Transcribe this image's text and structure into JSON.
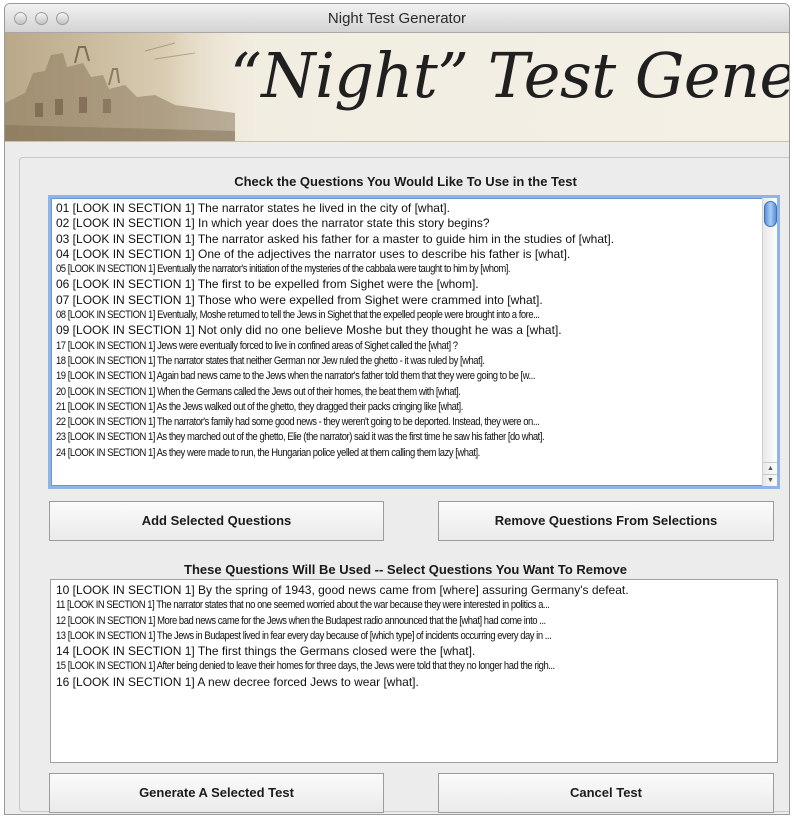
{
  "window": {
    "title": "Night Test Generator"
  },
  "banner": {
    "title": "“Night” Test Generator"
  },
  "available_section": {
    "label": "Check the Questions You Would Like To Use in the Test",
    "items": [
      "01 [LOOK IN SECTION 1]   The narrator states he lived in the city of [what].",
      "02 [LOOK IN SECTION 1]   In which year does the narrator state this story begins?",
      "03 [LOOK IN SECTION 1]   The narrator asked his father for a master to guide him in the studies of [what].",
      "04 [LOOK IN SECTION 1]   One of the adjectives the narrator uses to describe his father is [what].",
      "05 [LOOK IN SECTION 1]  Eventually the narrator's initiation of the mysteries of the cabbala were taught to him by [whom].",
      "06 [LOOK IN SECTION 1]   The first to be expelled from Sighet were the [whom].",
      "07 [LOOK IN SECTION 1]   Those who were expelled from Sighet were crammed into [what].",
      "08 [LOOK IN SECTION 1]  Eventually, Moshe returned to tell the Jews in Sighet that the expelled people were brought into a fore...",
      "09 [LOOK IN SECTION 1]   Not only did no one believe Moshe but they thought he was a [what].",
      "17 [LOOK IN SECTION 1]  Jews were eventually forced to live in confined areas of Sighet called the [what]  ?",
      "18 [LOOK IN SECTION 1]  The narrator states that neither German nor Jew ruled the ghetto - it was ruled by [what].",
      "19 [LOOK IN SECTION 1]  Again bad news came to the Jews when the narrator's father told them  that they were going to be [w...",
      "20 [LOOK IN SECTION 1]  When the Germans called the Jews out of their homes, the beat them with [what].",
      "21 [LOOK IN SECTION 1]  As the Jews walked out of the ghetto, they dragged their packs cringing like [what].",
      "22 [LOOK IN SECTION 1]  The narrator's family had some good news - they weren't going to be deported.  Instead, they were on...",
      "23 [LOOK IN SECTION 1]  As they marched out of the ghetto, Elie (the narrator) said it was the first time he saw his father [do what].",
      "24 [LOOK IN SECTION 1]  As they were made to run, the Hungarian police yelled at them calling them lazy [what]."
    ],
    "condensed": [
      false,
      false,
      false,
      false,
      true,
      false,
      false,
      true,
      false,
      true,
      true,
      true,
      true,
      true,
      true,
      true,
      true
    ]
  },
  "buttons": {
    "add": "Add Selected Questions",
    "remove": "Remove Questions From Selections",
    "generate": "Generate A Selected Test",
    "cancel": "Cancel Test"
  },
  "selected_section": {
    "label": "These Questions Will Be Used -- Select Questions You Want To Remove",
    "items": [
      "10 [LOOK IN SECTION 1]   By the spring of 1943, good news came from [where]   assuring Germany's defeat.",
      "11 [LOOK IN SECTION 1]   The narrator states that no one seemed worried about the war because they were interested in politics a...",
      "12 [LOOK IN SECTION 1]  More bad news came for the Jews when the Budapest radio announced that the [what]  had come into ...",
      "13 [LOOK IN SECTION 1]  The Jews in Budapest lived in fear every day because of [which type]  of incidents occurring every day in ...",
      "14 [LOOK IN SECTION 1]   The first things the Germans closed were the [what].",
      "15 [LOOK IN SECTION 1]  After being denied to leave their homes for three days, the Jews were told that they no longer had the righ...",
      "16 [LOOK IN SECTION 1]   A new decree forced Jews to wear [what]."
    ],
    "condensed": [
      false,
      true,
      true,
      true,
      false,
      true,
      false
    ]
  },
  "icons": {
    "scroll_up": "up-arrow-icon",
    "scroll_down": "down-arrow-icon"
  },
  "colors": {
    "focus_ring": "#8fb4e8",
    "scroll_thumb": "#5d92d9",
    "banner_bg": "#f2ede1"
  }
}
